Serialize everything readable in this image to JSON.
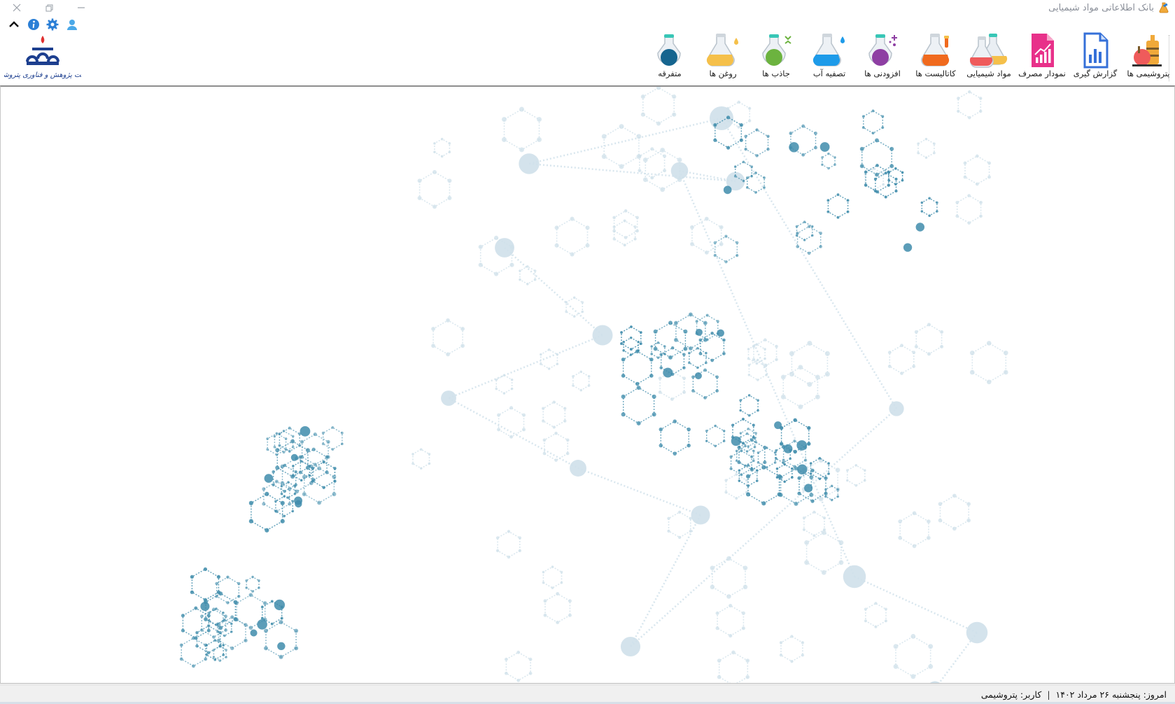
{
  "window": {
    "title": "بانک اطلاعاتی مواد شیمیایی",
    "app_icon": "flask-app-icon",
    "controls": [
      "close-icon",
      "restore-icon",
      "minimize-icon"
    ]
  },
  "toolbar": {
    "icons": [
      "collapse-chevron-icon",
      "info-icon",
      "settings-gear-icon",
      "user-icon"
    ]
  },
  "logo": {
    "text": "شرکت پژوهش و فناوری پتروشیمی"
  },
  "ribbon": {
    "items": [
      {
        "label": "پتروشیمی ها",
        "icon": "petrochemical-plant-icon"
      },
      {
        "label": "گزارش گیری",
        "icon": "report-document-icon"
      },
      {
        "label": "نمودار مصرف",
        "icon": "consumption-chart-icon"
      },
      {
        "label": "مواد شیمیایی",
        "icon": "chemicals-flasks-icon"
      },
      {
        "label": "کاتالیست ها",
        "icon": "catalyst-flask-icon"
      },
      {
        "label": "افزودنی ها",
        "icon": "additives-flask-icon"
      },
      {
        "label": "تصفیه آب",
        "icon": "water-treatment-flask-icon"
      },
      {
        "label": "جاذب ها",
        "icon": "absorbents-flask-icon"
      },
      {
        "label": "روغن ها",
        "icon": "oils-flask-icon"
      },
      {
        "label": "متفرقه",
        "icon": "misc-flask-icon"
      }
    ]
  },
  "background": {
    "image": "molecular-structure-illustration"
  },
  "status": {
    "date_label": "امروز: پنجشنبه ۲۶ مرداد ۱۴۰۲",
    "separator": "|",
    "user_label": "کاربر: پتروشیمی"
  },
  "colors": {
    "molecule_dark": "#3f8cab",
    "molecule_light": "#cfe0ea",
    "accent_blue": "#2b7fd6"
  }
}
